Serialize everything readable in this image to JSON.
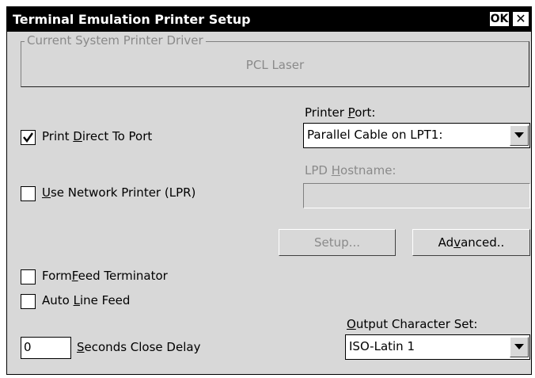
{
  "window": {
    "title": "Terminal Emulation Printer Setup",
    "ok_label": "OK",
    "close_label": "✕"
  },
  "driver_group": {
    "label": "Current System Printer Driver",
    "value": "PCL Laser"
  },
  "print_direct": {
    "pre": "Print ",
    "accel": "D",
    "post": "irect To Port",
    "checked": true
  },
  "printer_port": {
    "pre": "Printer ",
    "accel": "P",
    "post": "ort:",
    "selected": "Parallel Cable on LPT1:"
  },
  "use_network": {
    "pre": "",
    "accel": "U",
    "post": "se Network Printer (LPR)",
    "checked": false
  },
  "lpd_hostname": {
    "pre": "LPD ",
    "accel": "H",
    "post": "ostname:",
    "value": ""
  },
  "buttons": {
    "setup_label": "Setup...",
    "advanced_pre": "Ad",
    "advanced_accel": "v",
    "advanced_post": "anced.."
  },
  "formfeed": {
    "pre": "Form",
    "accel": "F",
    "post": "eed Terminator",
    "checked": false
  },
  "auto_line_feed": {
    "pre": "Auto ",
    "accel": "L",
    "post": "ine Feed",
    "checked": false
  },
  "close_delay": {
    "value": "0",
    "pre": "",
    "accel": "S",
    "post": "econds Close Delay"
  },
  "output_charset": {
    "pre": "",
    "accel": "O",
    "post": "utput Character Set:",
    "selected": "ISO-Latin 1"
  }
}
